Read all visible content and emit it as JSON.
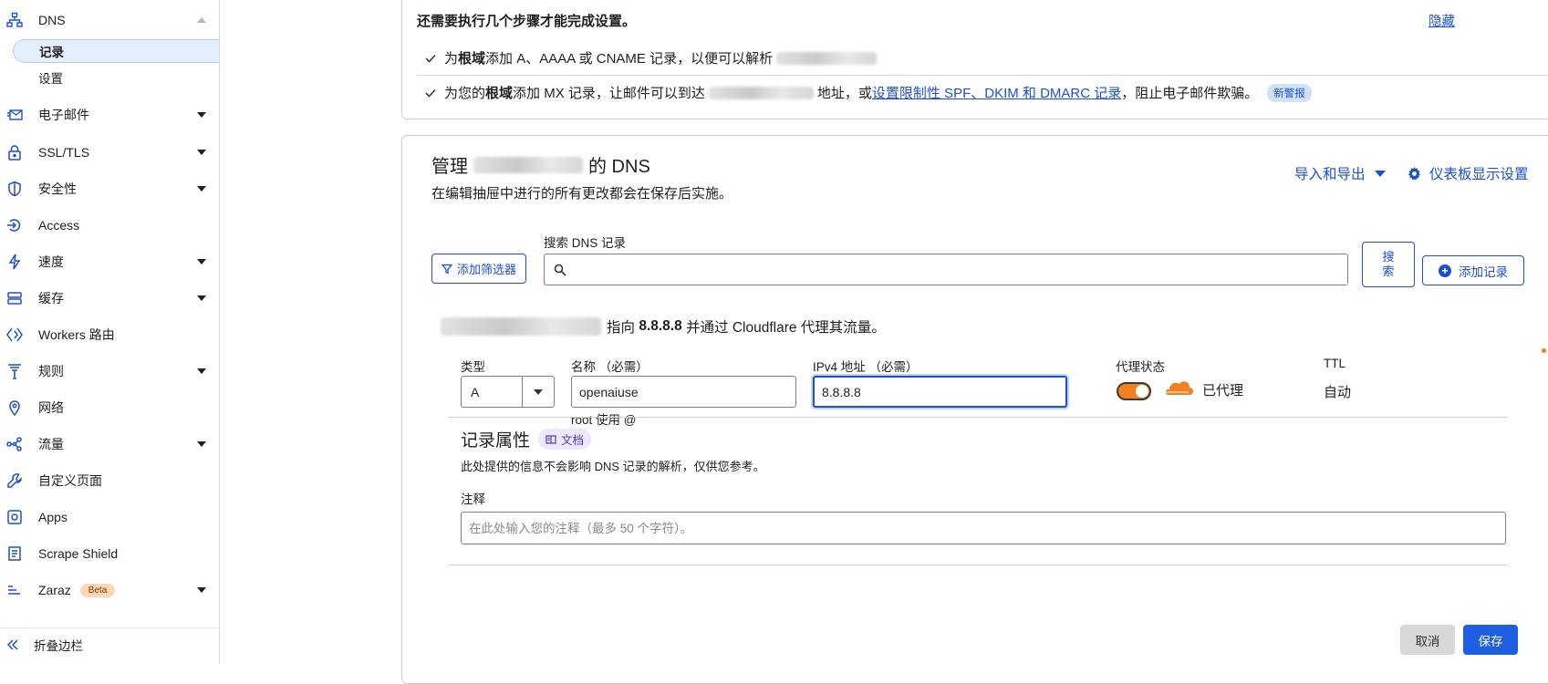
{
  "sidebar": {
    "dns_label": "DNS",
    "dns_sub": [
      {
        "label": "记录"
      },
      {
        "label": "设置"
      }
    ],
    "items": [
      {
        "label": "电子邮件",
        "icon": "email-routing-icon",
        "expandable": true
      },
      {
        "label": "SSL/TLS",
        "icon": "lock-icon",
        "expandable": true
      },
      {
        "label": "安全性",
        "icon": "shield-icon",
        "expandable": true
      },
      {
        "label": "Access",
        "icon": "access-icon",
        "expandable": false
      },
      {
        "label": "速度",
        "icon": "lightning-icon",
        "expandable": true
      },
      {
        "label": "缓存",
        "icon": "cache-stack-icon",
        "expandable": true
      },
      {
        "label": "Workers 路由",
        "icon": "workers-icon",
        "expandable": false
      },
      {
        "label": "规则",
        "icon": "rules-funnel-icon",
        "expandable": true
      },
      {
        "label": "网络",
        "icon": "location-pin-icon",
        "expandable": false
      },
      {
        "label": "流量",
        "icon": "traffic-nodes-icon",
        "expandable": true
      },
      {
        "label": "自定义页面",
        "icon": "wrench-icon",
        "expandable": false
      },
      {
        "label": "Apps",
        "icon": "apps-icon",
        "expandable": false
      },
      {
        "label": "Scrape Shield",
        "icon": "document-icon",
        "expandable": false
      },
      {
        "label": "Zaraz",
        "icon": "zaraz-icon",
        "expandable": true,
        "badge": "Beta"
      }
    ],
    "collapse_label": "折叠边栏"
  },
  "setup": {
    "title": "还需要执行几个步骤才能完成设置。",
    "hide": "隐藏",
    "step1": {
      "pre": "为",
      "bold": "根域",
      "post": "添加 A、AAAA 或 CNAME 记录，以便可以解析"
    },
    "step2": {
      "pre": "为您的",
      "bold": "根域",
      "mid": "添加 MX 记录，让邮件可以到达",
      "after_blur": "地址，或",
      "link": "设置限制性 SPF、DKIM 和 DMARC 记录",
      "post": "，阻止电子邮件欺骗。",
      "badge": "新警报"
    }
  },
  "dns": {
    "title_pre": "管理",
    "title_post": "的 DNS",
    "subtitle": "在编辑抽屉中进行的所有更改都会在保存后实施。",
    "import_export": "导入和导出",
    "dashboard_settings": "仪表板显示设置",
    "add_filter": "添加筛选器",
    "search_label": "搜索 DNS 记录",
    "search_value": "",
    "search_button": "搜索",
    "add_record": "添加记录",
    "preview": {
      "pre": "指向",
      "ip": "8.8.8.8",
      "post": "并通过 Cloudflare 代理其流量。"
    }
  },
  "form": {
    "type_label": "类型",
    "type_value": "A",
    "name_label": "名称 （必需）",
    "name_value": "openaiuse",
    "name_hint": "root 使用 @",
    "ipv4_label": "IPv4 地址 （必需）",
    "ipv4_value": "8.8.8.8",
    "proxy_label": "代理状态",
    "proxy_status": "已代理",
    "proxy_on": true,
    "ttl_label": "TTL",
    "ttl_value": "自动"
  },
  "props": {
    "title": "记录属性",
    "doc_badge": "文档",
    "subtitle": "此处提供的信息不会影响 DNS 记录的解析，仅供您参考。",
    "comment_label": "注释",
    "comment_placeholder": "在此处输入您的注释（最多 50 个字符）。",
    "comment_value": ""
  },
  "actions": {
    "cancel": "取消",
    "save": "保存"
  },
  "colors": {
    "accent": "#1d4fd1",
    "proxy_orange": "#f38020",
    "save_bg": "#1d5fe0"
  }
}
